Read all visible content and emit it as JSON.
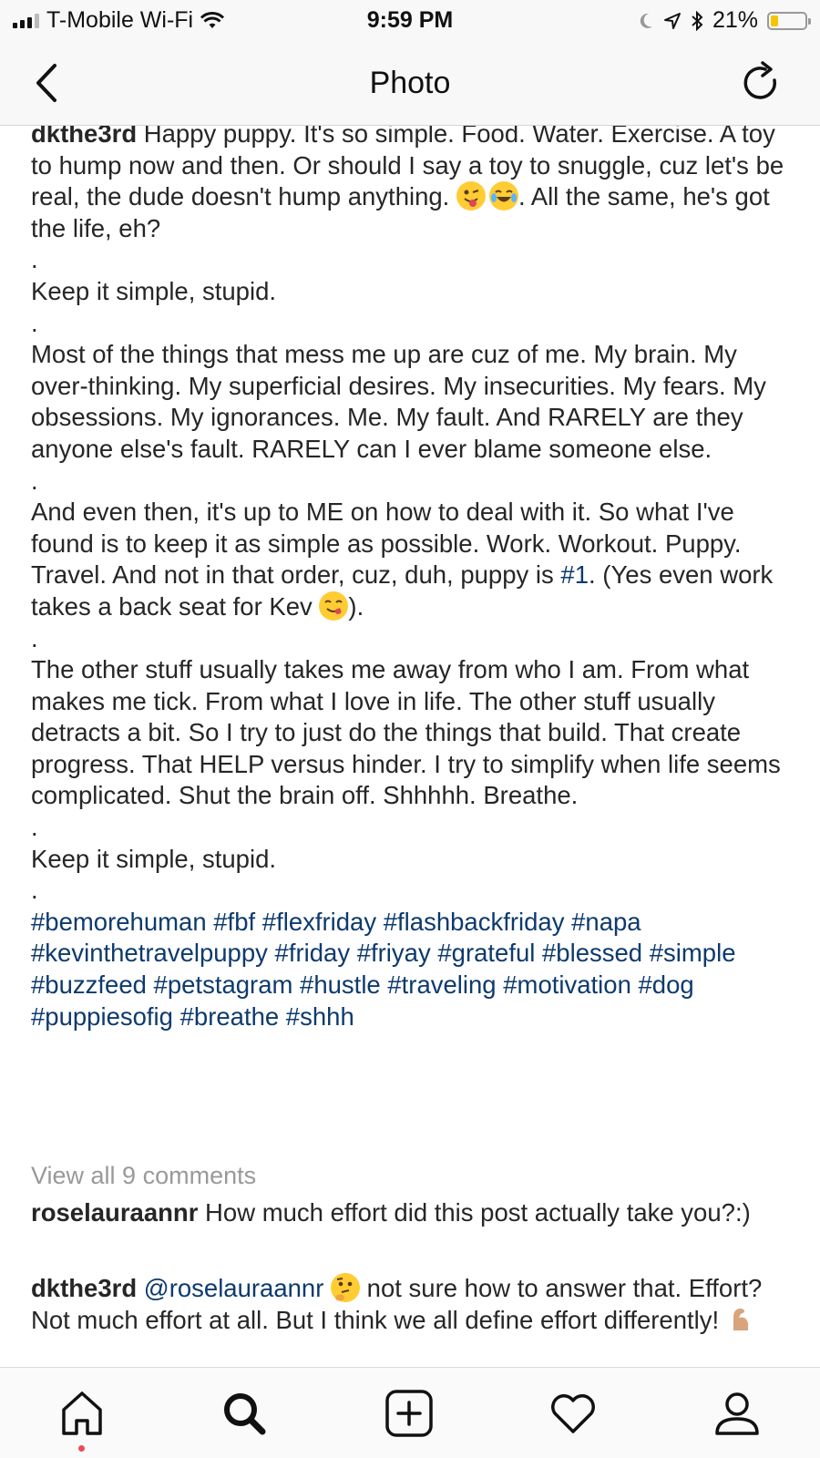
{
  "status_bar": {
    "carrier": "T-Mobile Wi-Fi",
    "time": "9:59 PM",
    "battery_percent": "21%",
    "battery_level": 0.21
  },
  "nav": {
    "title": "Photo"
  },
  "caption": {
    "username": "dkthe3rd",
    "p1a": " Happy puppy. It's so simple. Food. Water. Exercise. A toy to hump now and then. Or should I say a toy to snuggle, cuz let's be real, the dude doesn't hump anything. ",
    "p1b": ". All the same, he's got the life, eh?",
    "dot": ".",
    "p2": "Keep it simple, stupid.",
    "p3": "Most of the things that mess me up are cuz of me. My brain. My over-thinking. My superficial desires. My insecurities. My fears. My obsessions. My ignorances. Me. My fault. And RARELY are they anyone else's fault. RARELY can I ever blame someone else.",
    "p4a": "And even then, it's up to ME on how to deal with it. So what I've found is to keep it as simple as possible. Work. Workout. Puppy. Travel. And not in that order, cuz, duh, puppy is ",
    "p4_hashtag": "#1",
    "p4b": ". (Yes even work takes a back seat for Kev ",
    "p4c": ").",
    "p5": "The other stuff usually takes me away from who I am. From what makes me tick. From what I love in life. The other stuff usually detracts a bit. So I try to just do the things that build. That create progress. That HELP versus hinder. I try to simplify when life seems complicated. Shut the brain off. Shhhhh. Breathe.",
    "p6": "Keep it simple, stupid.",
    "hashtags": "#bemorehuman #fbf #flexfriday #flashbackfriday #napa #kevinthetravelpuppy #friday #friyay #grateful #blessed #simple #buzzfeed #petstagram #hustle #traveling #motivation #dog #puppiesofig #breathe #shhh",
    "emojis": [
      "winking-tongue-face-emoji",
      "tears-of-joy-emoji",
      "yum-face-emoji"
    ]
  },
  "view_all_comments": "View all 9 comments",
  "comments": [
    {
      "username": "roselauraannr",
      "text": " How much effort did this post actually take you?:)"
    },
    {
      "username": "dkthe3rd",
      "mention": "@roselauraannr",
      "text_a": " not sure how to answer that. Effort? Not much effort at all. But I think we all define effort differently! ",
      "emojis": [
        "thinking-face-emoji",
        "flexed-biceps-emoji"
      ]
    }
  ],
  "tab_bar": {
    "icons": [
      "home-icon",
      "search-icon",
      "add-post-icon",
      "activity-heart-icon",
      "profile-icon"
    ],
    "active": "search-icon"
  },
  "colors": {
    "hashtag": "#0d3a6e",
    "muted": "#999999",
    "text": "#262626",
    "notification_dot": "#ed4956",
    "battery_fill": "#f5c400"
  }
}
